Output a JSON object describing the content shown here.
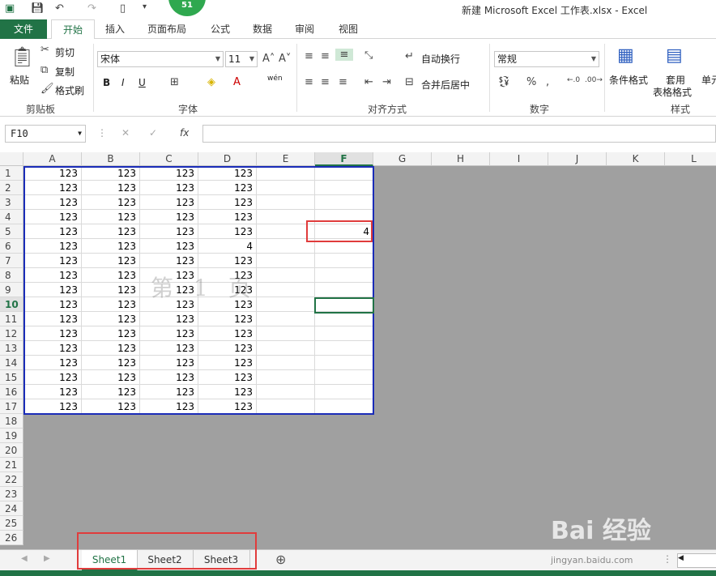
{
  "titlebar": {
    "title": "新建 Microsoft Excel 工作表.xlsx - Excel",
    "notification_count": "51"
  },
  "tabs": [
    "文件",
    "开始",
    "插入",
    "页面布局",
    "公式",
    "数据",
    "审阅",
    "视图"
  ],
  "ribbon": {
    "clipboard": {
      "paste": "粘贴",
      "cut": "剪切",
      "copy": "复制",
      "format_painter": "格式刷",
      "label": "剪贴板"
    },
    "font": {
      "name": "宋体",
      "size": "11",
      "bold": "B",
      "italic": "I",
      "underline": "U",
      "label": "字体",
      "wen": "wén"
    },
    "alignment": {
      "wrap": "自动换行",
      "merge": "合并后居中",
      "label": "对齐方式"
    },
    "number": {
      "format": "常规",
      "label": "数字"
    },
    "styles": {
      "conditional": "条件格式",
      "table1": "套用",
      "table2": "表格格式",
      "cell_styles": "单元",
      "label": "样式"
    }
  },
  "formula_bar": {
    "name_box": "F10",
    "fx": "fx",
    "value": ""
  },
  "columns": [
    "A",
    "B",
    "C",
    "D",
    "E",
    "F",
    "G",
    "H",
    "I",
    "J",
    "K",
    "L"
  ],
  "rows": [
    "1",
    "2",
    "3",
    "4",
    "5",
    "6",
    "7",
    "8",
    "9",
    "10",
    "11",
    "12",
    "13",
    "14",
    "15",
    "16",
    "17",
    "18",
    "19",
    "20",
    "21",
    "22",
    "23",
    "24",
    "25",
    "26"
  ],
  "cells": [
    [
      "123",
      "123",
      "123",
      "123",
      "",
      ""
    ],
    [
      "123",
      "123",
      "123",
      "123",
      "",
      ""
    ],
    [
      "123",
      "123",
      "123",
      "123",
      "",
      ""
    ],
    [
      "123",
      "123",
      "123",
      "123",
      "",
      ""
    ],
    [
      "123",
      "123",
      "123",
      "123",
      "",
      "4"
    ],
    [
      "123",
      "123",
      "123",
      "4",
      "",
      ""
    ],
    [
      "123",
      "123",
      "123",
      "123",
      "",
      ""
    ],
    [
      "123",
      "123",
      "123",
      "123",
      "",
      ""
    ],
    [
      "123",
      "123",
      "123",
      "123",
      "",
      ""
    ],
    [
      "123",
      "123",
      "123",
      "123",
      "",
      ""
    ],
    [
      "123",
      "123",
      "123",
      "123",
      "",
      ""
    ],
    [
      "123",
      "123",
      "123",
      "123",
      "",
      ""
    ],
    [
      "123",
      "123",
      "123",
      "123",
      "",
      ""
    ],
    [
      "123",
      "123",
      "123",
      "123",
      "",
      ""
    ],
    [
      "123",
      "123",
      "123",
      "123",
      "",
      ""
    ],
    [
      "123",
      "123",
      "123",
      "123",
      "",
      ""
    ],
    [
      "123",
      "123",
      "123",
      "123",
      "",
      ""
    ]
  ],
  "page_watermark": "第 1 页",
  "selected_cell": "F10",
  "sheets": [
    "Sheet1",
    "Sheet2",
    "Sheet3"
  ],
  "active_sheet": "Sheet1",
  "baidu_logo": "Bai 经验",
  "baidu_url": "jingyan.baidu.com",
  "colors": {
    "excel_green": "#217346",
    "print_border": "#1a2cb8",
    "highlight_red": "#e03c3c",
    "background_gray": "#a0a0a0"
  }
}
